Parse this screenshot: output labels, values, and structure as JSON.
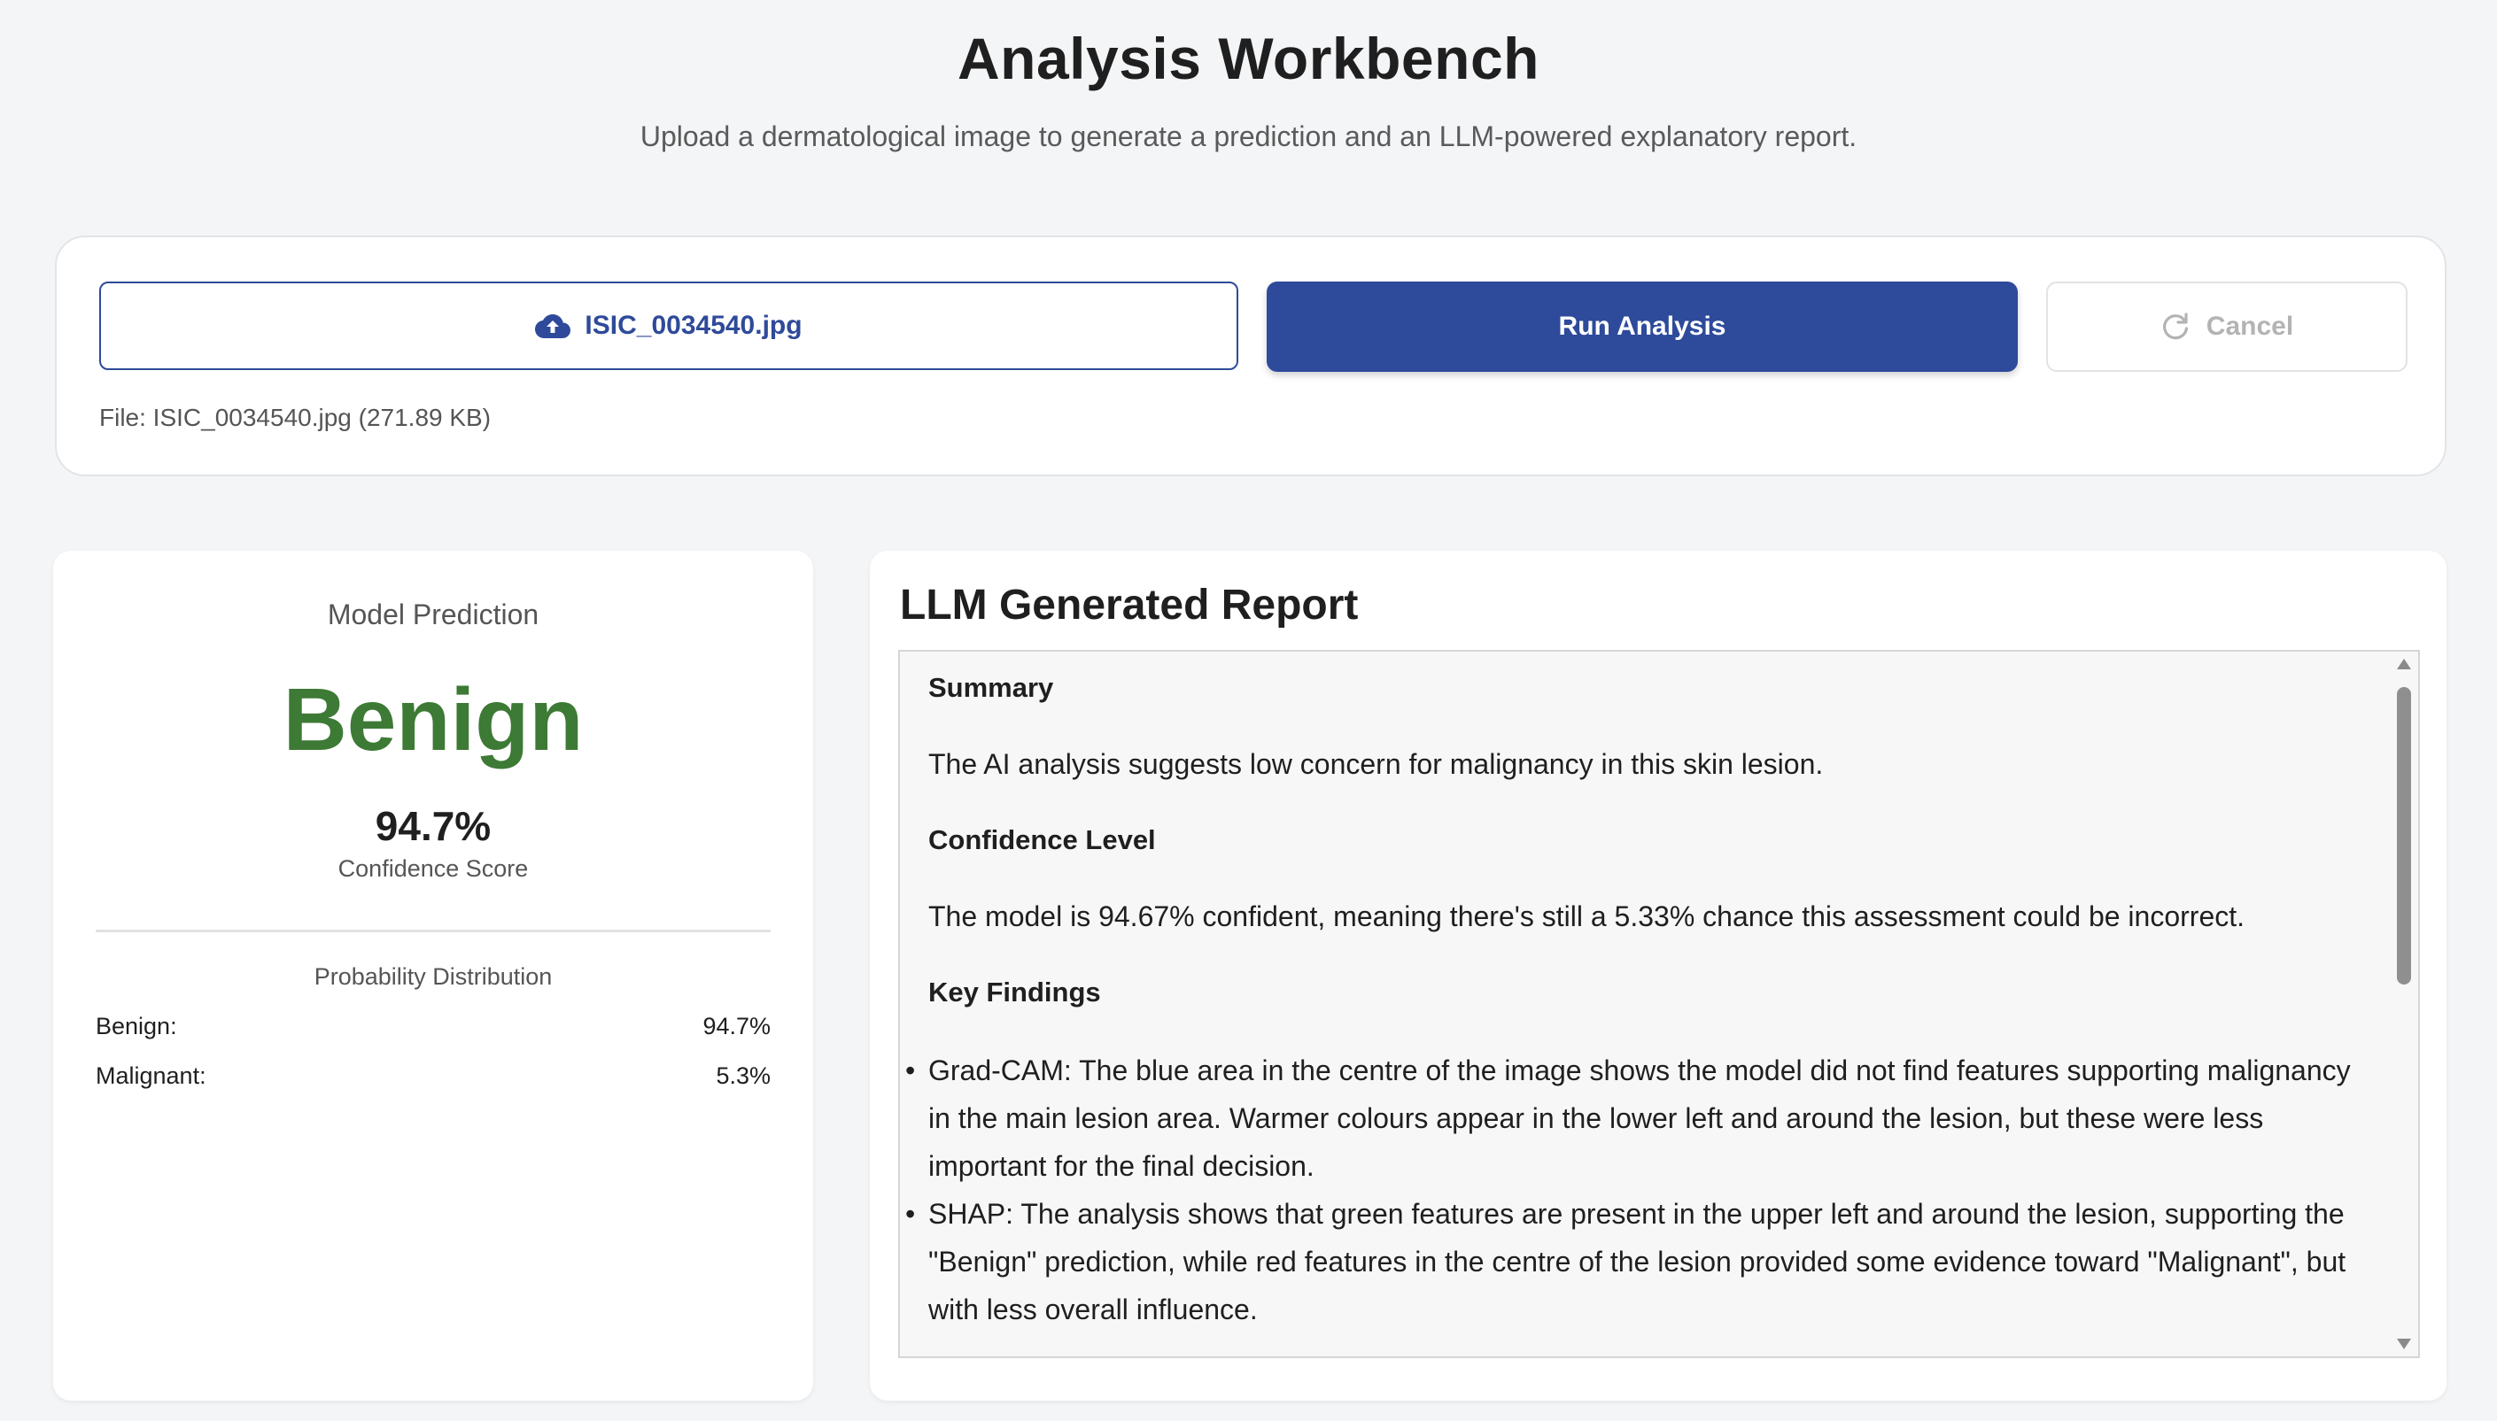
{
  "header": {
    "title": "Analysis Workbench",
    "subtitle": "Upload a dermatological image to generate a prediction and an LLM-powered explanatory report."
  },
  "upload": {
    "file_button_label": "ISIC_0034540.jpg",
    "file_button_icon": "cloud-upload-icon",
    "run_label": "Run Analysis",
    "cancel_label": "Cancel",
    "cancel_icon": "refresh-icon",
    "file_info": "File: ISIC_0034540.jpg (271.89 KB)"
  },
  "prediction": {
    "label": "Model Prediction",
    "value": "Benign",
    "value_color": "#3d7a35",
    "score": "94.7%",
    "score_label": "Confidence Score",
    "distribution_title": "Probability Distribution",
    "distribution": [
      {
        "name": "Benign:",
        "value": "94.7%"
      },
      {
        "name": "Malignant:",
        "value": "5.3%"
      }
    ]
  },
  "report": {
    "title": "LLM Generated Report",
    "summary_heading": "Summary",
    "summary_text": "The AI analysis suggests low concern for malignancy in this skin lesion.",
    "confidence_heading": "Confidence Level",
    "confidence_text": "The model is 94.67% confident, meaning there's still a 5.33% chance this assessment could be incorrect.",
    "findings_heading": "Key Findings",
    "findings": [
      "Grad-CAM: The blue area in the centre of the image shows the model did not find features supporting malignancy in the main lesion area. Warmer colours appear in the lower left and around the lesion, but these were less important for the final decision.",
      "SHAP: The analysis shows that green features are present in the upper left and around the lesion, supporting the \"Benign\" prediction, while red features in the centre of the lesion provided some evidence toward \"Malignant\", but with less overall influence."
    ]
  },
  "colors": {
    "primary": "#2d4a9b",
    "benign": "#3d7a35",
    "background": "#f4f5f7"
  }
}
